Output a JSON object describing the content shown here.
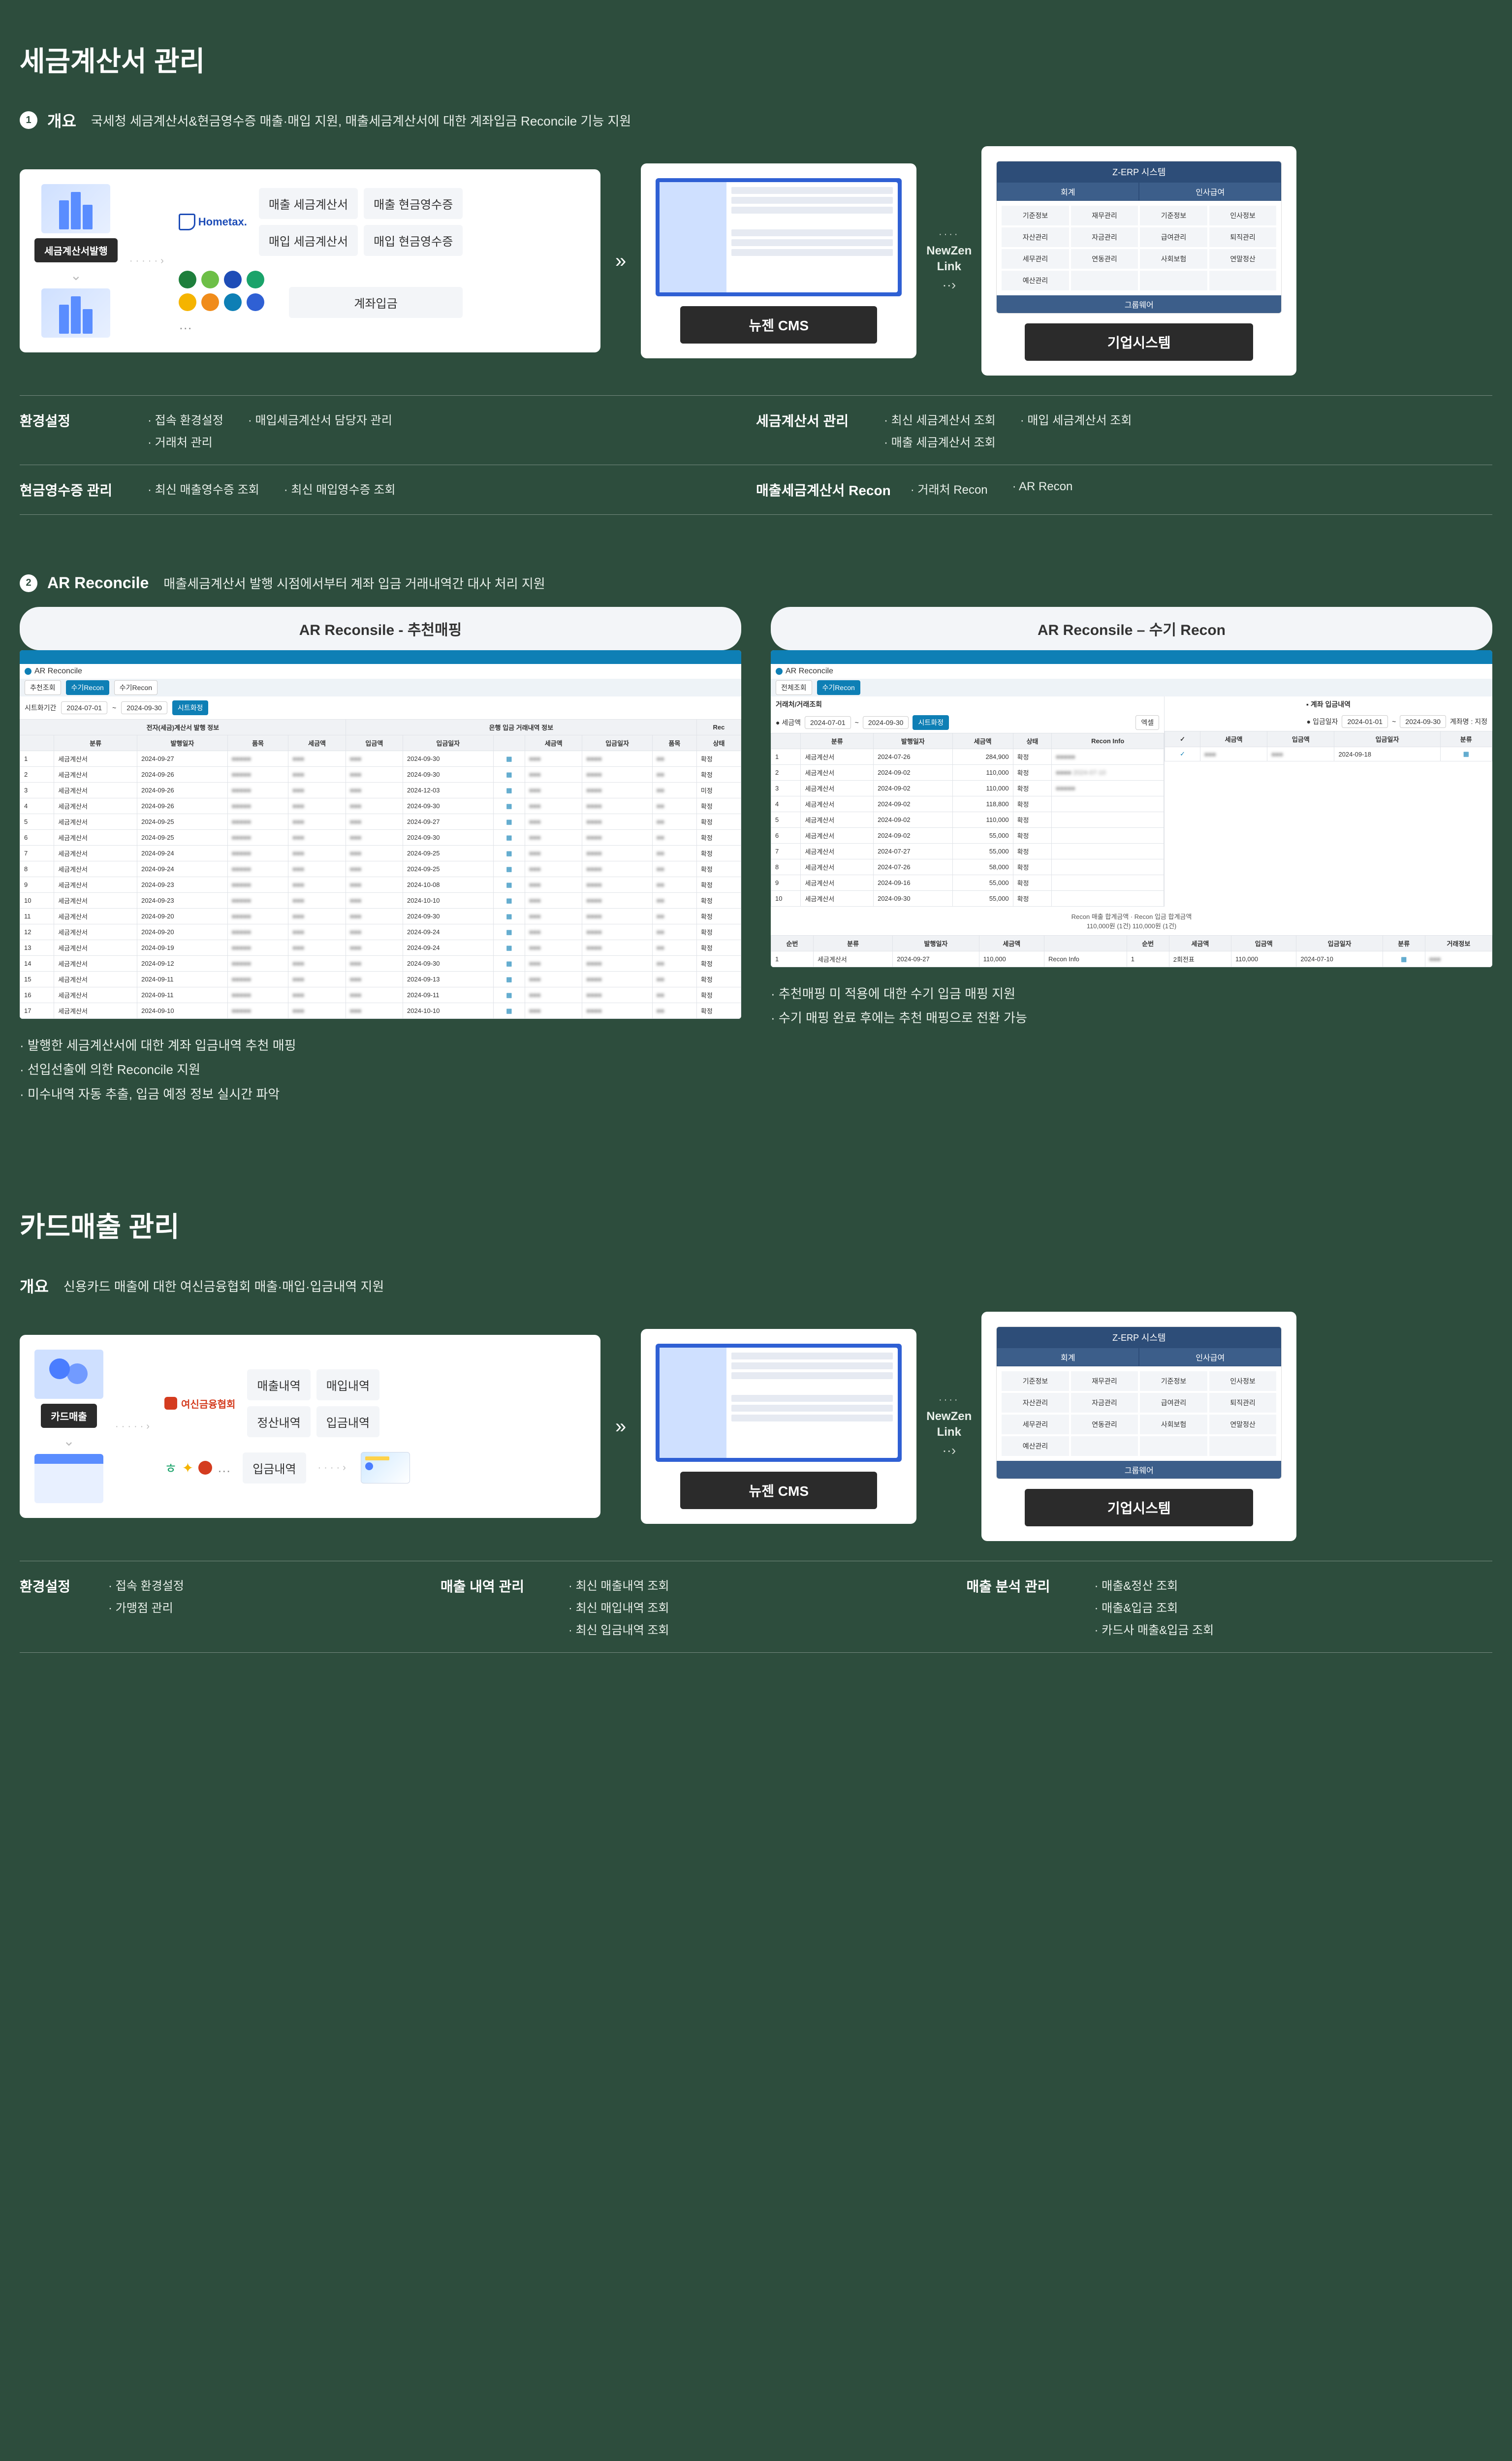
{
  "section1": {
    "title": "세금계산서 관리",
    "item1": {
      "num": "1",
      "label": "개요",
      "desc": "국세청 세금계산서&현금영수증 매출·매입 지원, 매출세금계산서에 대한 계좌입금 Reconcile 기능 지원"
    },
    "flow": {
      "issue_label": "세금계산서발행",
      "hometax": "Hom﻿etax.",
      "chips": {
        "c1": "매출 세금계산서",
        "c2": "매출 현금영수증",
        "c3": "매입 세금계산서",
        "c4": "매입 현금영수증",
        "deposit": "계좌입금"
      },
      "arrow": "»",
      "link": "NewZen\nLink",
      "cms_caption": "뉴젠 CMS",
      "erp_caption": "기업시스템",
      "erp": {
        "header": "Z-ERP 시스템",
        "tab1": "회계",
        "tab2": "인사급여",
        "cells": [
          "기준정보",
          "재무관리",
          "기준정보",
          "인사정보",
          "자산관리",
          "자금관리",
          "급여관리",
          "퇴직관리",
          "세무관리",
          "연동관리",
          "사회보험",
          "연말정산",
          "예산관리",
          "",
          "",
          ""
        ],
        "footer": "그룹웨어"
      }
    },
    "features": {
      "r1": {
        "b1": {
          "title": "환경설정",
          "items": [
            "접속 환경설정",
            "거래처 관리",
            "매입세금계산서 담당자 관리"
          ]
        },
        "b2": {
          "title": "세금계산서 관리",
          "items": [
            "최신 세금계산서 조회",
            "매출 세금계산서 조회",
            "매입 세금계산서 조회"
          ]
        }
      },
      "r2": {
        "b1": {
          "title": "현금영수증 관리",
          "items": [
            "최신 매출영수증 조회",
            "최신 매입영수증 조회"
          ]
        },
        "b2": {
          "title": "매출세금계산서 Recon",
          "items": [
            "거래처 Recon",
            "AR Recon"
          ]
        }
      }
    },
    "item2": {
      "num": "2",
      "label": "AR Reconcile",
      "desc": "매출세금계산서 발행 시점에서부터 계좌 입금 거래내역간 대사 처리 지원",
      "tab1": "AR Reconsile - 추천매핑",
      "tab2": "AR Reconsile – 수기 Recon",
      "left_bullets": [
        "발행한 세금계산서에 대한 계좌 입금내역 추천 매핑",
        "선입선출에 의한 Reconcile 지원",
        "미수내역 자동 추출, 입금 예정 정보 실시간 파악"
      ],
      "right_bullets": [
        "추천매핑 미 적용에 대한 수기 입금 매핑 지원",
        "수기 매핑 완료 후에는 추천 매핑으로 전환 가능"
      ],
      "mock": {
        "title": "AR Reconcile",
        "tabs": [
          "추천조회",
          "수기Recon",
          "수기Recon"
        ],
        "date_label": "시트화기간",
        "date_from": "2024-07-01",
        "date_to": "2024-09-30",
        "search_btn": "시트화정",
        "left_header": "전자(세금)계산서 발행 정보",
        "right_header": "은행 입금 거래내역 정보",
        "cols_left": [
          "",
          "분류",
          "발행일자",
          "품목",
          "세금액",
          "입금액",
          "입금일자"
        ],
        "cols_right": [
          "",
          "세금액",
          "입금액",
          "입금일자",
          "품목",
          "상태"
        ],
        "rows": [
          {
            "n": "1",
            "k": "세금계산서",
            "d": "2024-09-27",
            "dd": "2024-09-30",
            "s": "확정"
          },
          {
            "n": "2",
            "k": "세금계산서",
            "d": "2024-09-26",
            "dd": "2024-09-30",
            "s": "확정"
          },
          {
            "n": "3",
            "k": "세금계산서",
            "d": "2024-09-26",
            "dd": "2024-12-03",
            "s": "미정"
          },
          {
            "n": "4",
            "k": "세금계산서",
            "d": "2024-09-26",
            "dd": "2024-09-30",
            "s": "확정"
          },
          {
            "n": "5",
            "k": "세금계산서",
            "d": "2024-09-25",
            "dd": "2024-09-27",
            "s": "확정"
          },
          {
            "n": "6",
            "k": "세금계산서",
            "d": "2024-09-25",
            "dd": "2024-09-30",
            "s": "확정"
          },
          {
            "n": "7",
            "k": "세금계산서",
            "d": "2024-09-24",
            "dd": "2024-09-25",
            "s": "확정"
          },
          {
            "n": "8",
            "k": "세금계산서",
            "d": "2024-09-24",
            "dd": "2024-09-25",
            "s": "확정"
          },
          {
            "n": "9",
            "k": "세금계산서",
            "d": "2024-09-23",
            "dd": "2024-10-08",
            "s": "확정"
          },
          {
            "n": "10",
            "k": "세금계산서",
            "d": "2024-09-23",
            "dd": "2024-10-10",
            "s": "확정"
          },
          {
            "n": "11",
            "k": "세금계산서",
            "d": "2024-09-20",
            "dd": "2024-09-30",
            "s": "확정"
          },
          {
            "n": "12",
            "k": "세금계산서",
            "d": "2024-09-20",
            "dd": "2024-09-24",
            "s": "확정"
          },
          {
            "n": "13",
            "k": "세금계산서",
            "d": "2024-09-19",
            "dd": "2024-09-24",
            "s": "확정"
          },
          {
            "n": "14",
            "k": "세금계산서",
            "d": "2024-09-12",
            "dd": "2024-09-30",
            "s": "확정"
          },
          {
            "n": "15",
            "k": "세금계산서",
            "d": "2024-09-11",
            "dd": "2024-09-13",
            "s": "확정"
          },
          {
            "n": "16",
            "k": "세금계산서",
            "d": "2024-09-11",
            "dd": "2024-09-11",
            "s": "확정"
          },
          {
            "n": "17",
            "k": "세금계산서",
            "d": "2024-09-10",
            "dd": "2024-10-10",
            "s": "확정"
          }
        ],
        "mock2": {
          "tab_a": "전체조회",
          "tab_b": "수기Recon",
          "panel_title": "거래처/거래조회",
          "recon_title": "계좌 입금내역",
          "date_from": "2024-07-01",
          "date_to": "2024-09-30",
          "search": "시트화정",
          "date_from2": "2024-01-01",
          "date_to2": "2024-09-30",
          "filter": "계좌명 : 지정",
          "cols1": [
            "",
            "분류",
            "발행일자",
            "세금액",
            "상태",
            "Recon Info"
          ],
          "cols2": [
            "✓",
            "세금액",
            "입금액",
            "입금일자",
            "분류"
          ],
          "rows1": [
            {
              "n": "1",
              "k": "세금계산서",
              "d": "2024-07-26",
              "a": "284,900",
              "s": "확정",
              "r": "■■■■■"
            },
            {
              "n": "2",
              "k": "세금계산서",
              "d": "2024-09-02",
              "a": "110,000",
              "s": "확정",
              "r": "■■■■  2024-07-10"
            },
            {
              "n": "3",
              "k": "세금계산서",
              "d": "2024-09-02",
              "a": "110,000",
              "s": "확정",
              "r": "■■■■■"
            },
            {
              "n": "4",
              "k": "세금계산서",
              "d": "2024-09-02",
              "a": "118,800",
              "s": "확정",
              "r": ""
            },
            {
              "n": "5",
              "k": "세금계산서",
              "d": "2024-09-02",
              "a": "110,000",
              "s": "확정",
              "r": ""
            },
            {
              "n": "6",
              "k": "세금계산서",
              "d": "2024-09-02",
              "a": "55,000",
              "s": "확정",
              "r": ""
            },
            {
              "n": "7",
              "k": "세금계산서",
              "d": "2024-07-27",
              "a": "55,000",
              "s": "확정",
              "r": ""
            },
            {
              "n": "8",
              "k": "세금계산서",
              "d": "2024-07-26",
              "a": "58,000",
              "s": "확정",
              "r": ""
            },
            {
              "n": "9",
              "k": "세금계산서",
              "d": "2024-09-16",
              "a": "55,000",
              "s": "확정",
              "r": ""
            },
            {
              "n": "10",
              "k": "세금계산서",
              "d": "2024-09-30",
              "a": "55,000",
              "s": "확정",
              "r": ""
            }
          ],
          "deposit_row": {
            "chk": "✓",
            "a1": "■■■",
            "a2": "■■■",
            "d": "2024-09-18",
            "k": "■"
          },
          "summary_label": "Recon 매출 합계금액 · Recon 입금 합계금액",
          "summary_val": "110,000원 (1건)   110,000원 (1건)",
          "bottom_cols": [
            "순번",
            "분류",
            "발행일자",
            "세금액",
            "  ",
            "순번",
            "세금액",
            "입금액",
            "입금일자",
            "분류",
            "거래정보"
          ],
          "bottom_row": {
            "n": "1",
            "k": "세금계산서",
            "d": "2024-09-27",
            "a": "110,000",
            "ri": "Recon Info",
            "dn": "1",
            "ddn": "2회전표",
            "da": "110,000",
            "dd": "2024-07-10"
          }
        }
      }
    }
  },
  "section2": {
    "title": "카드매출 관리",
    "item": {
      "label": "개요",
      "desc": "신용카드 매출에 대한 여신금융협회 매출·매입·입금내역 지원"
    },
    "flow": {
      "sales_label": "카드매출",
      "yeosin": "여신금융협회",
      "chips": {
        "c1": "매출내역",
        "c2": "매입내역",
        "c3": "정산내역",
        "c4": "입금내역",
        "deposit": "입금내역"
      },
      "arrow": "»",
      "link": "NewZen\nLink",
      "cms_caption": "뉴젠 CMS",
      "erp_caption": "기업시스템"
    },
    "features": {
      "b1": {
        "title": "환경설정",
        "items": [
          "접속 환경설정",
          "가맹점 관리"
        ]
      },
      "b2": {
        "title": "매출 내역 관리",
        "items": [
          "최신 매출내역 조회",
          "최신 매입내역 조회",
          "최신 입금내역 조회"
        ]
      },
      "b3": {
        "title": "매출 분석 관리",
        "items": [
          "매출&정산 조회",
          "매출&입금 조회",
          "카드사 매출&입금 조회"
        ]
      }
    }
  }
}
